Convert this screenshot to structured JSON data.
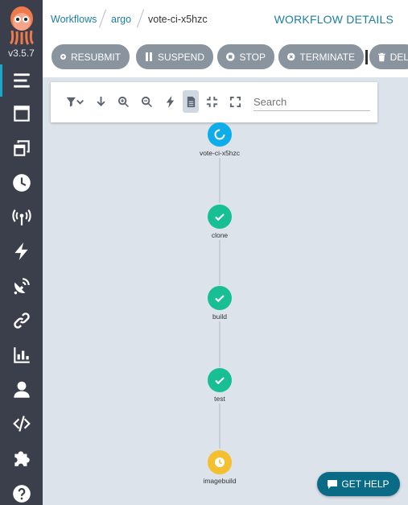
{
  "app": {
    "version": "v3.5.7"
  },
  "breadcrumb": {
    "items": [
      "Workflows",
      "argo",
      "vote-ci-x5hzc"
    ]
  },
  "page_title": "WORKFLOW DETAILS",
  "toolbar": {
    "resubmit": "RESUBMIT",
    "suspend": "SUSPEND",
    "stop": "STOP",
    "terminate": "TERMINATE",
    "delete": "DEL"
  },
  "graph_controls": {
    "search_placeholder": "Search"
  },
  "nodes": [
    {
      "label": "vote-ci-x5hzc",
      "status": "running"
    },
    {
      "label": "clone",
      "status": "succeeded"
    },
    {
      "label": "build",
      "status": "succeeded"
    },
    {
      "label": "test",
      "status": "succeeded"
    },
    {
      "label": "imagebuild",
      "status": "pending"
    }
  ],
  "help_button": "GET HELP",
  "colors": {
    "sidebar": "#3a3f4b",
    "accent": "#1b7ea5",
    "succeeded": "#18be94",
    "running": "#0dadea",
    "pending": "#f4c030",
    "canvas": "#dde3ea"
  }
}
